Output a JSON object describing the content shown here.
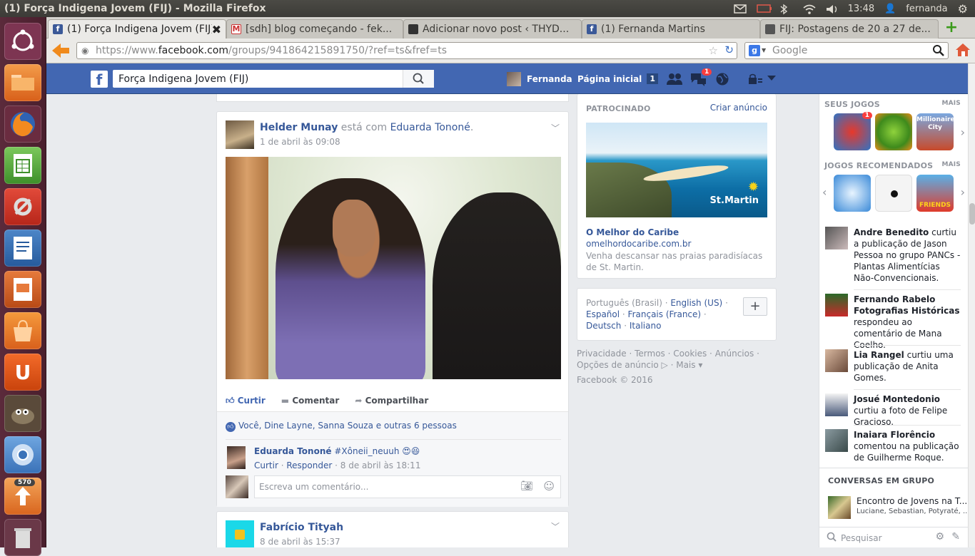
{
  "os": {
    "window_title": "(1) Força Indigena Jovem (FIJ) - Mozilla Firefox",
    "time": "13:48",
    "user": "fernanda",
    "launcher_badge": "570"
  },
  "browser": {
    "tabs": [
      {
        "label": "(1) Força Indigena Jovem (FIJ)",
        "active": true
      },
      {
        "label": "[sdh] blog começando - fek..."
      },
      {
        "label": "Adicionar novo post ‹ THYD..."
      },
      {
        "label": "(1) Fernanda Martins"
      },
      {
        "label": "FIJ: Postagens de 20 a 27 de..."
      }
    ],
    "url_prefix": "https://www.",
    "url_domain": "facebook.com",
    "url_path": "/groups/941864215891750/?ref=ts&fref=ts",
    "search_placeholder": "Google"
  },
  "fb": {
    "search_value": "Força Indigena Jovem (FIJ)",
    "user": "Fernanda",
    "home": "Página inicial",
    "home_count": "1",
    "messages_badge": "1",
    "post1": {
      "author": "Helder Munay",
      "with_text": "está com",
      "with": "Eduarda Tononé",
      "dot": ".",
      "time": "1 de abril às 09:08",
      "like": "Curtir",
      "comment": "Comentar",
      "share": "Compartilhar",
      "likes_text": "Você, Dine Layne, Sanna Souza e outras 6 pessoas",
      "comment_author": "Eduarda Tononé",
      "comment_text": "#Xôneii_neuuh 😍😆",
      "comment_like": "Curtir",
      "comment_reply": "Responder",
      "comment_time": "8 de abril às 18:11",
      "comment_placeholder": "Escreva um comentário..."
    },
    "post2": {
      "author": "Fabrício Tityah",
      "time": "8 de abril às 15:37"
    },
    "ad": {
      "label": "PATROCINADO",
      "create": "Criar anúncio",
      "title": "O Melhor do Caribe",
      "domain": "omelhordocaribe.com.br",
      "desc": "Venha descansar nas praias paradisíacas de St. Martin.",
      "image_text": "St.Martin"
    },
    "languages": {
      "current": "Português (Brasil)",
      "list": [
        "English (US)",
        "Español",
        "Français (France)",
        "Deutsch",
        "Italiano"
      ]
    },
    "footer": {
      "links": [
        "Privacidade",
        "Termos",
        "Cookies",
        "Anúncios",
        "Opções de anúncio",
        "Mais"
      ],
      "copyright": "Facebook © 2016"
    },
    "sidebar": {
      "games_header": "SEUS JOGOS",
      "more": "MAIS",
      "rec_header": "JOGOS RECOMENDADOS",
      "game_badge": "1",
      "game_label_3": "Millionaire City",
      "rec_label_3": "FRIENDS",
      "activity": [
        {
          "name": "Andre Benedito",
          "text": "curtiu a publicação de Jason Pessoa no grupo PANCs - Plantas Alimentícias Não-Convencionais."
        },
        {
          "name": "Fernando Rabelo Fotografias Históricas",
          "text": "respondeu ao comentário de Mana Coelho."
        },
        {
          "name": "Lia Rangel",
          "text": "curtiu uma publicação de Anita Gomes."
        },
        {
          "name": "Josué Montedonio",
          "text": "curtiu a foto de Felipe Gracioso."
        },
        {
          "name": "Inaiara Florêncio",
          "text": "comentou na publicação de Guilherme Roque."
        }
      ],
      "group_header": "CONVERSAS EM GRUPO",
      "group_title": "Encontro de Jovens na T...",
      "group_members": "Luciane, Sebastian, Potyraté, ...",
      "chat_search": "Pesquisar"
    }
  }
}
